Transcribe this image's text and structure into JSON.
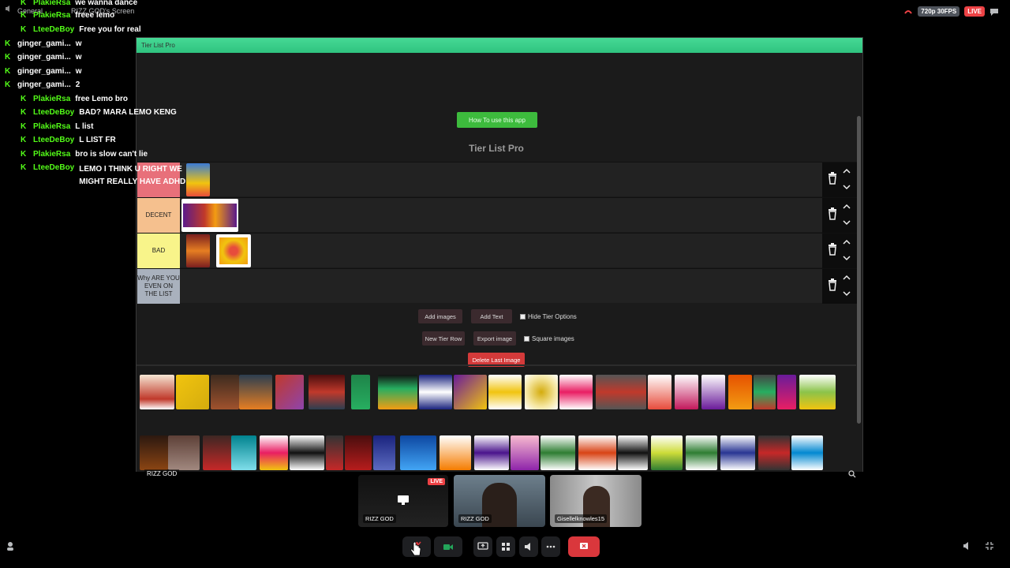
{
  "topbar": {
    "channel": "General",
    "screen_label": "RIZZ GOD's Screen",
    "quality": "720p 30FPS",
    "live": "LIVE"
  },
  "chat": [
    {
      "kick": true,
      "user": "PlakieRsa",
      "user_color": "green",
      "msg": "we wanna dance"
    },
    {
      "kick": true,
      "user": "PlakieRsa",
      "user_color": "green",
      "msg": "freee lemo"
    },
    {
      "kick": true,
      "user": "LteeDeBoy",
      "user_color": "green",
      "msg": "Free you for real"
    },
    {
      "kick": true,
      "user": "ginger_gami...",
      "user_color": "white",
      "msg": "w"
    },
    {
      "kick": true,
      "user": "ginger_gami...",
      "user_color": "white",
      "msg": "w"
    },
    {
      "kick": true,
      "user": "ginger_gami...",
      "user_color": "white",
      "msg": "w"
    },
    {
      "kick": true,
      "user": "ginger_gami...",
      "user_color": "white",
      "msg": "2"
    },
    {
      "kick": true,
      "user": "PlakieRsa",
      "user_color": "green",
      "msg": "free Lemo bro"
    },
    {
      "kick": true,
      "user": "LteeDeBoy",
      "user_color": "green",
      "msg": "BAD? MARA LEMO KENG"
    },
    {
      "kick": true,
      "user": "PlakieRsa",
      "user_color": "green",
      "msg": "L list"
    },
    {
      "kick": true,
      "user": "LteeDeBoy",
      "user_color": "green",
      "msg": "L LIST FR"
    },
    {
      "kick": true,
      "user": "PlakieRsa",
      "user_color": "green",
      "msg": "bro is slow can't lie"
    },
    {
      "kick": true,
      "user": "LteeDeBoy",
      "user_color": "green",
      "msg": "LEMO I THINK U RIGHT WE MIGHT REALLY HAVE ADHD"
    }
  ],
  "window": {
    "title": "Tier List Pro",
    "howto_label": "How To use this app",
    "app_title": "Tier List Pro",
    "tiers": [
      {
        "label": "",
        "color": "#e8707a"
      },
      {
        "label": "DECENT",
        "color": "#f5c08e"
      },
      {
        "label": "BAD",
        "color": "#f8f48a"
      },
      {
        "label": "Why ARE YOU EVEN ON THE LIST",
        "color": "#a9b1bd"
      }
    ],
    "buttons": {
      "add_images": "Add images",
      "add_text": "Add Text",
      "hide_tier_options": "Hide Tier Options",
      "new_tier_row": "New Tier Row",
      "export_image": "Export image",
      "square_images": "Square images",
      "delete_last_image": "Delete Last Image"
    },
    "sharer": "RIZZ GOD"
  },
  "participants": [
    {
      "name": "RIZZ GOD",
      "live": "LIVE"
    },
    {
      "name": "RIZZ GOD"
    },
    {
      "name": "Gisellelknowles15"
    }
  ],
  "colors": {
    "accent_green": "#53fc18",
    "title_bar": "#2fc37f",
    "howto_button": "#3dbb3d",
    "delete_button": "#d43a3a",
    "leave_button": "#da373c"
  }
}
